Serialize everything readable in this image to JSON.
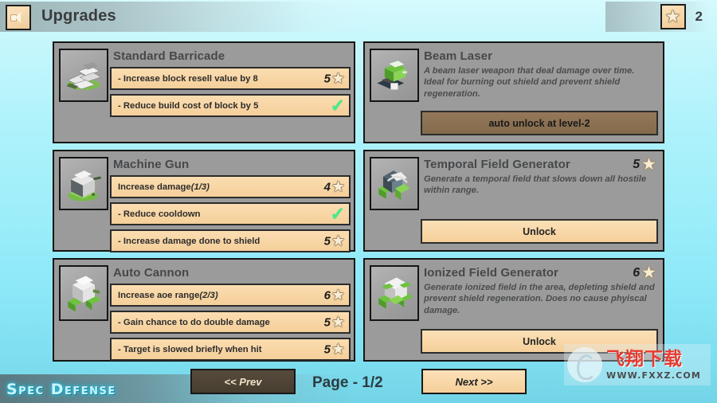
{
  "header": {
    "title": "Upgrades",
    "sound_icon": "speaker-icon",
    "star_icon": "star-icon",
    "star_count": "2"
  },
  "cards": [
    {
      "name": "Standard Barricade",
      "icon": "barricade-tower-icon",
      "type": "upgrades",
      "rows": [
        {
          "label": "- Increase block resell value by 8",
          "cost": "5",
          "state": "purchasable",
          "star_icon": "star-icon"
        },
        {
          "label": "- Reduce build cost of block by 5",
          "cost": "",
          "state": "owned",
          "check_icon": "checkmark-icon"
        }
      ]
    },
    {
      "name": "Beam Laser",
      "icon": "beam-laser-tower-icon",
      "type": "locked",
      "description": "A beam laser weapon that deal damage over time. Ideal for burning out shield and prevent shield regeneration.",
      "button_label": "auto unlock at level-2",
      "button_state": "disabled"
    },
    {
      "name": "Machine Gun",
      "icon": "machine-gun-tower-icon",
      "type": "upgrades",
      "rows": [
        {
          "label": "Increase damage",
          "suffix": "(1/3)",
          "cost": "4",
          "state": "purchasable",
          "star_icon": "star-icon"
        },
        {
          "label": "- Reduce cooldown",
          "cost": "",
          "state": "owned",
          "check_icon": "checkmark-icon"
        },
        {
          "label": "- Increase damage done to shield",
          "cost": "5",
          "state": "purchasable",
          "star_icon": "star-icon"
        }
      ]
    },
    {
      "name": "Temporal Field Generator",
      "icon": "temporal-field-tower-icon",
      "type": "unlockable",
      "cost": "5",
      "star_icon": "star-icon",
      "description": "Generate a temporal field that slows down all hostile within range.",
      "button_label": "Unlock",
      "button_state": "enabled"
    },
    {
      "name": "Auto Cannon",
      "icon": "auto-cannon-tower-icon",
      "type": "upgrades",
      "rows": [
        {
          "label": "Increase aoe range",
          "suffix": "(2/3)",
          "cost": "6",
          "state": "purchasable",
          "star_icon": "star-icon"
        },
        {
          "label": "- Gain chance to do double damage",
          "cost": "5",
          "state": "purchasable",
          "star_icon": "star-icon"
        },
        {
          "label": "- Target is slowed briefly when hit",
          "cost": "5",
          "state": "purchasable",
          "star_icon": "star-icon"
        }
      ]
    },
    {
      "name": "Ionized Field Generator",
      "icon": "ionized-field-tower-icon",
      "type": "unlockable",
      "cost": "6",
      "star_icon": "star-icon",
      "description": "Generate ionized field in the area, depleting shield and prevent shield regeneration. Does no cause phyiscal damage.",
      "button_label": "Unlock",
      "button_state": "enabled"
    }
  ],
  "footer": {
    "brand": "Spec Defense",
    "prev_label": "<< Prev",
    "page_label": "Page - 1/2",
    "next_label": "Next >>"
  },
  "watermark": {
    "text_cn": "飞翔下载",
    "url": "WWW.FXXZ.COM"
  },
  "colors": {
    "row_tan": "#f8d7a7",
    "card_gray": "#9b9b9b",
    "check_green": "#3ff08a",
    "disabled_brown": "#8b7152",
    "background_cyan": "#9eeefa"
  }
}
